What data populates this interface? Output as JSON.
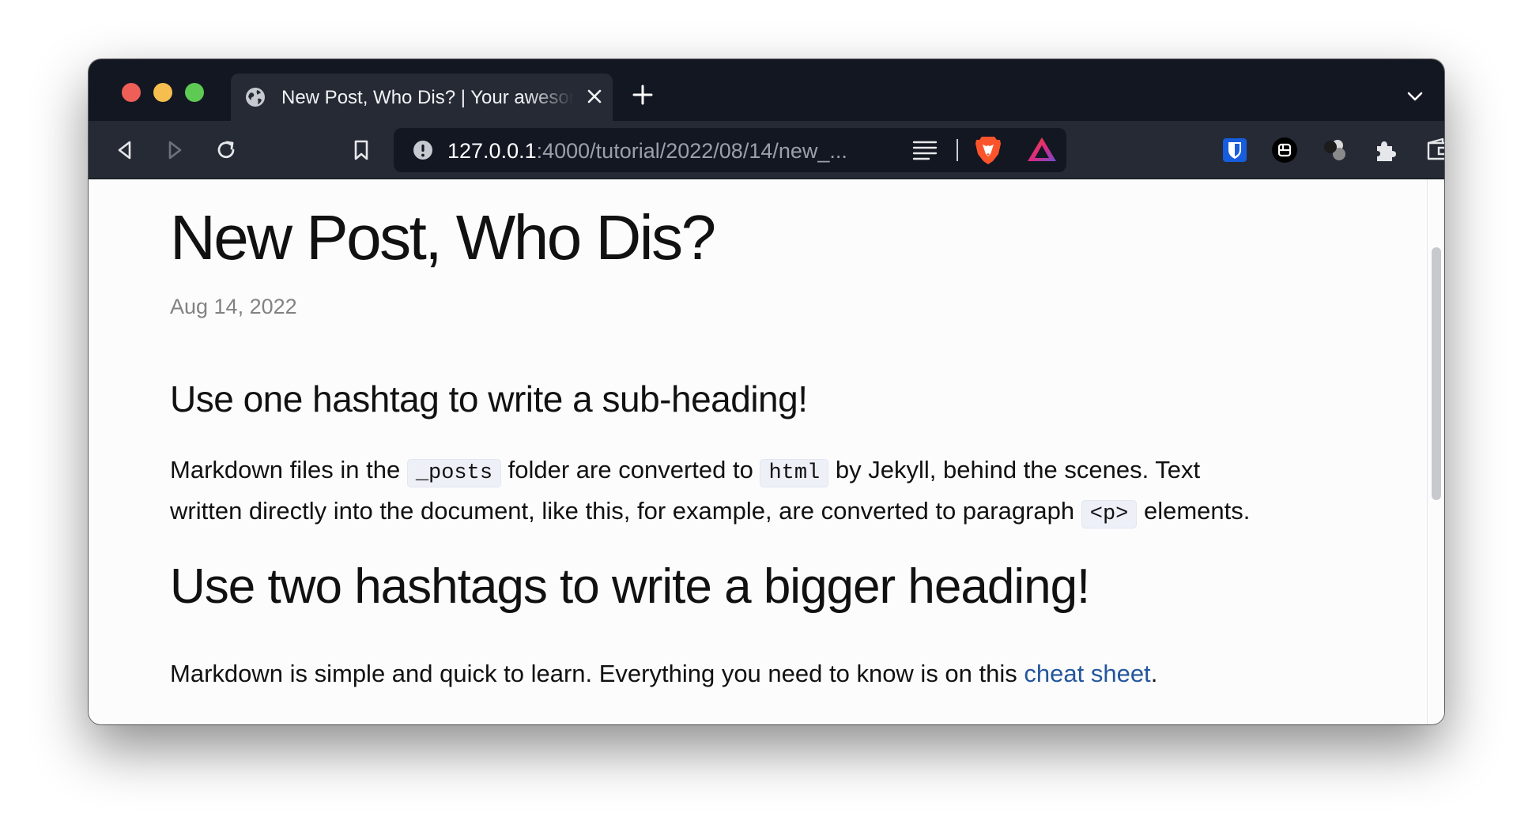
{
  "browser": {
    "tab": {
      "title": "New Post, Who Dis? | Your awesome title"
    },
    "address_bar": {
      "host": "127.0.0.1",
      "rest": ":4000/tutorial/2022/08/14/new_..."
    },
    "icons": {
      "back": "back-arrow-icon",
      "forward": "forward-arrow-icon",
      "reload": "reload-icon",
      "bookmark": "bookmark-icon",
      "info": "info-icon",
      "reader": "reader-mode-icon",
      "brave_shields": "brave-lion-icon",
      "rewards": "brave-rewards-icon",
      "bitwarden": "bitwarden-shield-icon",
      "extension_a": "extension-box-icon",
      "extension_b": "extension-balls-icon",
      "extensions": "puzzle-piece-icon",
      "wallet": "wallet-icon",
      "menu": "menu-icon"
    },
    "colors": {
      "chrome_dark": "#131722",
      "toolbar": "#252a35",
      "brave_orange": "#fb542b",
      "bitwarden_blue": "#175ddc"
    }
  },
  "post": {
    "title": "New Post, Who Dis?",
    "date": "Aug 14, 2022",
    "subheading": "Use one hashtag to write a sub-heading!",
    "para1": {
      "t1": "Markdown files in the ",
      "code1": "_posts",
      "t2": " folder are converted to ",
      "code2": "html",
      "t3": " by Jekyll, behind the scenes. Text",
      "t4": "written directly into the document, like this, for example, are converted to paragraph ",
      "code3": "<p>",
      "t5": " elements."
    },
    "bigger_heading": "Use two hashtags to write a bigger heading!",
    "para2": {
      "t1": "Markdown is simple and quick to learn. Everything you need to know is on this ",
      "link": "cheat sheet",
      "t2": "."
    },
    "link_color": "#24569c"
  }
}
